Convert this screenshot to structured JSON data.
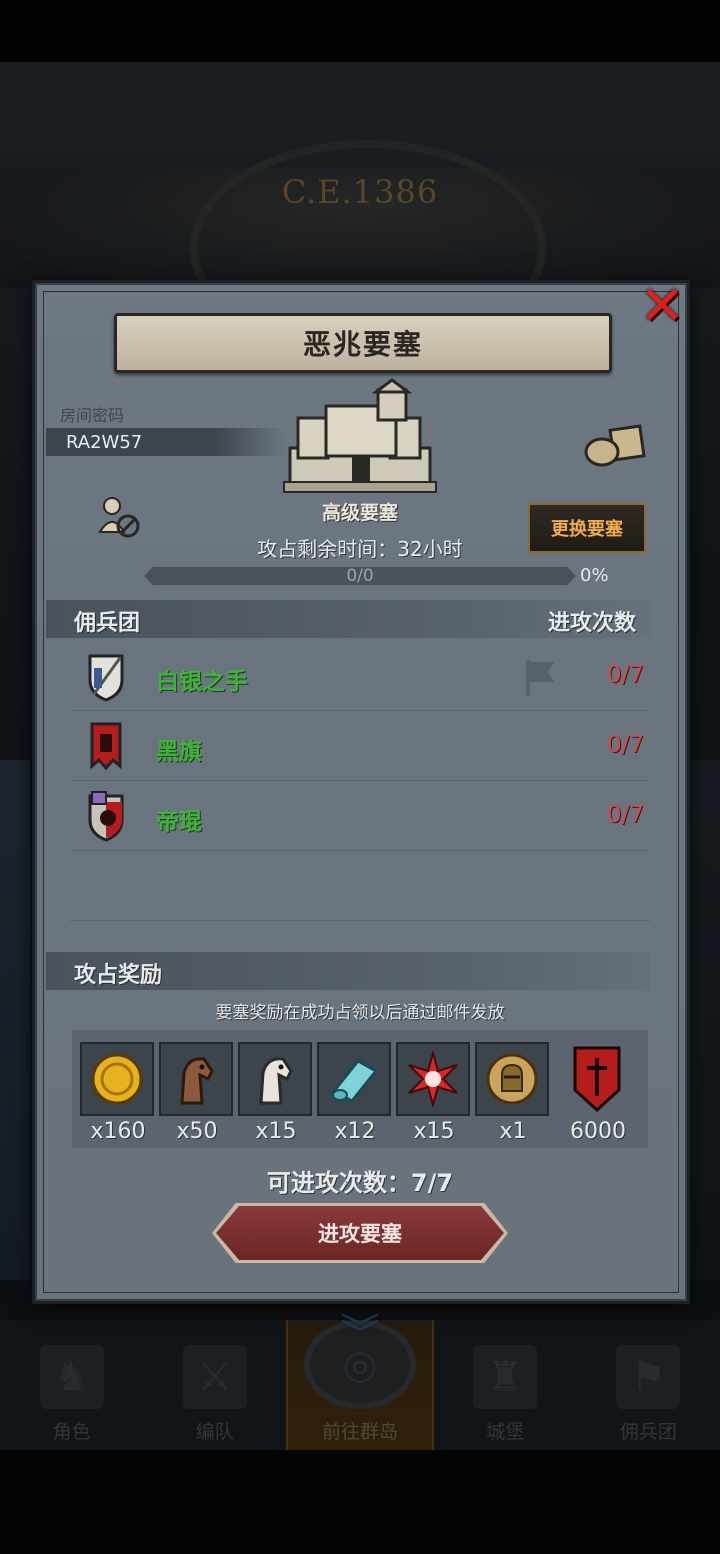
{
  "background": {
    "era_label": "C.E.1386"
  },
  "bottom_nav": [
    {
      "label": "角色",
      "icon": "character-icon"
    },
    {
      "label": "编队",
      "icon": "formation-icon"
    },
    {
      "label": "前往群岛",
      "icon": "archipelago-icon",
      "active": true
    },
    {
      "label": "城堡",
      "icon": "castle-icon"
    },
    {
      "label": "佣兵团",
      "icon": "mercenary-icon"
    }
  ],
  "modal": {
    "title": "恶兆要塞",
    "room_label": "房间密码",
    "room_code": "RA2W57",
    "fortress_name": "高级要塞",
    "change_button": "更换要塞",
    "time_remaining": "攻占剩余时间：32小时",
    "progress_text": "0/0",
    "progress_pct": "0%",
    "progress_value": 0,
    "section_mercenary": "佣兵团",
    "section_attacks": "进攻次数",
    "mercenaries": [
      {
        "name": "白银之手",
        "count": "0/7",
        "emblem": "silver-hand-emblem-icon"
      },
      {
        "name": "黑旗",
        "count": "0/7",
        "emblem": "black-flag-emblem-icon"
      },
      {
        "name": "帝琨",
        "count": "0/7",
        "emblem": "dikun-emblem-icon"
      }
    ],
    "section_rewards": "攻占奖励",
    "reward_note": "要塞奖励在成功占领以后通过邮件发放",
    "rewards": [
      {
        "qty": "x160",
        "icon": "gold-coin-icon"
      },
      {
        "qty": "x50",
        "icon": "brown-horse-icon"
      },
      {
        "qty": "x15",
        "icon": "white-horse-icon"
      },
      {
        "qty": "x12",
        "icon": "cloth-roll-icon"
      },
      {
        "qty": "x15",
        "icon": "red-star-icon"
      },
      {
        "qty": "x1",
        "icon": "knight-helmet-coin-icon"
      },
      {
        "qty": "6000",
        "icon": "red-banner-icon"
      }
    ],
    "attacks_available": "可进攻次数：7/7",
    "attack_button": "进攻要塞"
  },
  "colors": {
    "close": "#d8221d",
    "merc_name": "#3fb23a",
    "count": "#d24a4a",
    "change_btn_text": "#f1ab4a"
  }
}
